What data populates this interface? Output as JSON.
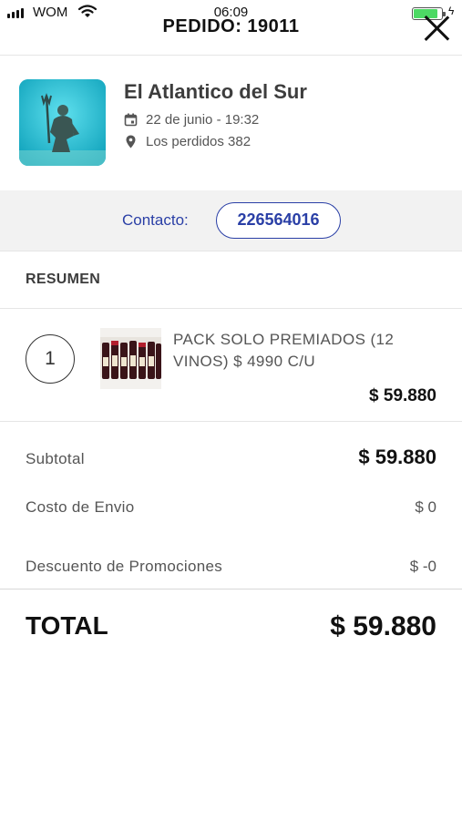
{
  "status_bar": {
    "carrier": "WOM",
    "time": "06:09",
    "battery_level": 0.9
  },
  "header": {
    "title": "PEDIDO: 19011"
  },
  "store": {
    "name": "El Atlantico del Sur",
    "datetime": "22 de junio - 19:32",
    "address": "Los perdidos 382"
  },
  "contact": {
    "label": "Contacto:",
    "phone": "226564016"
  },
  "summary": {
    "title": "RESUMEN",
    "items": [
      {
        "quantity": "1",
        "name": "PACK SOLO PREMIADOS (12 VINOS) $ 4990 C/U",
        "total": "$ 59.880"
      }
    ]
  },
  "totals": {
    "subtotal_label": "Subtotal",
    "subtotal_value": "$ 59.880",
    "shipping_label": "Costo de Envio",
    "shipping_value": "$ 0",
    "discount_label": "Descuento de Promociones",
    "discount_value": "$ -0",
    "total_label": "TOTAL",
    "total_value": "$ 59.880"
  },
  "colors": {
    "accent": "#2a3fa6",
    "band": "#f2f2f2",
    "battery": "#4cd964"
  }
}
